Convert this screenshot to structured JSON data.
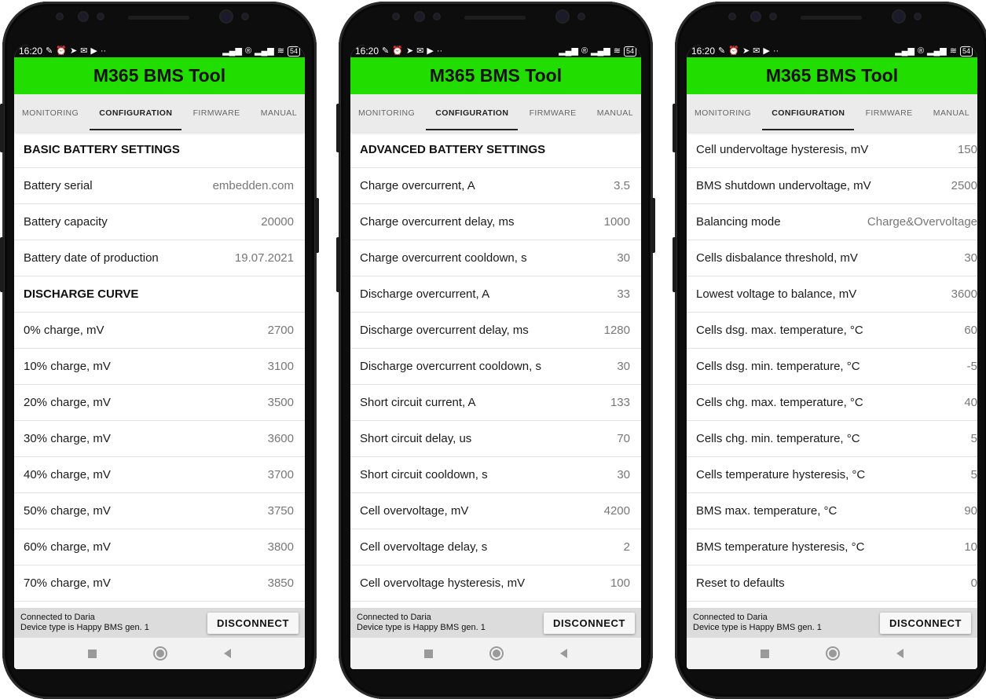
{
  "status_bar": {
    "time": "16:20",
    "battery": "54"
  },
  "app": {
    "title": "M365 BMS Tool",
    "accent_color": "#22dd00"
  },
  "tabs": [
    "MONITORING",
    "CONFIGURATION",
    "FIRMWARE",
    "MANUAL"
  ],
  "active_tab": "CONFIGURATION",
  "footer": {
    "connected": "Connected to Daria",
    "device": "Device type is Happy BMS gen. 1",
    "disconnect_label": "DISCONNECT"
  },
  "screens": [
    {
      "sections": [
        {
          "title": "BASIC BATTERY SETTINGS",
          "rows": [
            {
              "label": "Battery serial",
              "value": "embedden.com"
            },
            {
              "label": "Battery capacity",
              "value": "20000"
            },
            {
              "label": "Battery date of production",
              "value": "19.07.2021"
            }
          ]
        },
        {
          "title": "DISCHARGE CURVE",
          "rows": [
            {
              "label": "0% charge, mV",
              "value": "2700"
            },
            {
              "label": "10% charge, mV",
              "value": "3100"
            },
            {
              "label": "20% charge, mV",
              "value": "3500"
            },
            {
              "label": "30% charge, mV",
              "value": "3600"
            },
            {
              "label": "40% charge, mV",
              "value": "3700"
            },
            {
              "label": "50% charge, mV",
              "value": "3750"
            },
            {
              "label": "60% charge, mV",
              "value": "3800"
            },
            {
              "label": "70% charge, mV",
              "value": "3850"
            }
          ]
        }
      ]
    },
    {
      "sections": [
        {
          "title": "ADVANCED BATTERY SETTINGS",
          "rows": [
            {
              "label": "Charge overcurrent, A",
              "value": "3.5"
            },
            {
              "label": "Charge overcurrent delay, ms",
              "value": "1000"
            },
            {
              "label": "Charge overcurrent cooldown, s",
              "value": "30"
            },
            {
              "label": "Discharge overcurrent, A",
              "value": "33"
            },
            {
              "label": "Discharge overcurrent delay, ms",
              "value": "1280"
            },
            {
              "label": "Discharge overcurrent cooldown, s",
              "value": "30"
            },
            {
              "label": "Short circuit current, A",
              "value": "133"
            },
            {
              "label": "Short circuit delay, us",
              "value": "70"
            },
            {
              "label": "Short circuit cooldown, s",
              "value": "30"
            },
            {
              "label": "Cell overvoltage, mV",
              "value": "4200"
            },
            {
              "label": "Cell overvoltage delay, s",
              "value": "2"
            },
            {
              "label": "Cell overvoltage hysteresis, mV",
              "value": "100"
            }
          ]
        }
      ]
    },
    {
      "sections": [
        {
          "title": "",
          "rows": [
            {
              "label": "Cell undervoltage hysteresis, mV",
              "value": "150"
            },
            {
              "label": "BMS shutdown undervoltage, mV",
              "value": "2500"
            },
            {
              "label": "Balancing mode",
              "value": "Charge&Overvoltage"
            },
            {
              "label": "Cells disbalance threshold, mV",
              "value": "30"
            },
            {
              "label": "Lowest voltage to balance, mV",
              "value": "3600"
            },
            {
              "label": "Cells dsg. max. temperature, °C",
              "value": "60"
            },
            {
              "label": "Cells dsg. min. temperature, °C",
              "value": "-5"
            },
            {
              "label": "Cells chg. max. temperature, °C",
              "value": "40"
            },
            {
              "label": "Cells chg. min. temperature, °C",
              "value": "5"
            },
            {
              "label": "Cells temperature hysteresis, °C",
              "value": "5"
            },
            {
              "label": "BMS max. temperature, °C",
              "value": "90"
            },
            {
              "label": "BMS temperature hysteresis, °C",
              "value": "10"
            },
            {
              "label": "Reset to defaults",
              "value": "0"
            }
          ]
        }
      ]
    }
  ]
}
